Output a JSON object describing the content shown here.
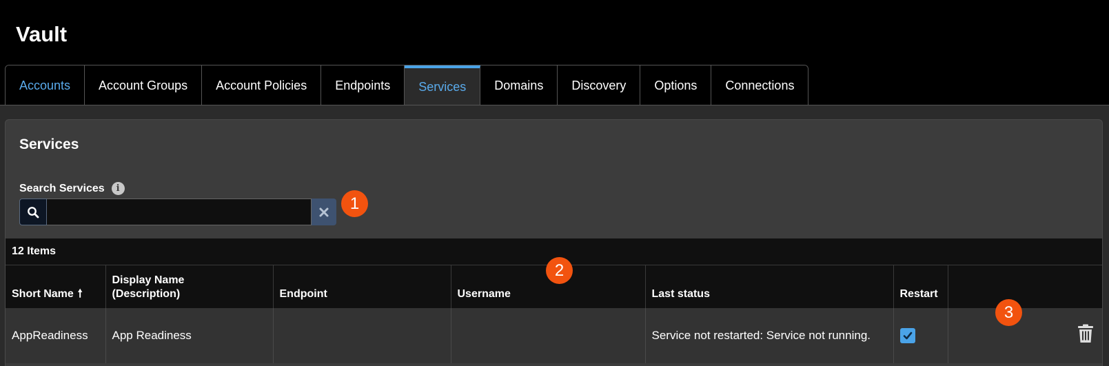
{
  "app": {
    "title": "Vault"
  },
  "tabs": [
    {
      "label": "Accounts",
      "state": "link"
    },
    {
      "label": "Account Groups",
      "state": "normal"
    },
    {
      "label": "Account Policies",
      "state": "normal"
    },
    {
      "label": "Endpoints",
      "state": "normal"
    },
    {
      "label": "Services",
      "state": "active"
    },
    {
      "label": "Domains",
      "state": "normal"
    },
    {
      "label": "Discovery",
      "state": "normal"
    },
    {
      "label": "Options",
      "state": "normal"
    },
    {
      "label": "Connections",
      "state": "normal"
    }
  ],
  "panel": {
    "title": "Services",
    "search": {
      "label": "Search Services",
      "value": "",
      "placeholder": ""
    }
  },
  "grid": {
    "count_label": "12 Items",
    "columns": [
      "Short Name",
      "Display Name\n(Description)",
      "Endpoint",
      "Username",
      "Last status",
      "Restart",
      ""
    ],
    "rows": [
      {
        "short_name": "AppReadiness",
        "display_name": "App Readiness",
        "endpoint": "",
        "username": "",
        "last_status": "Service not restarted: Service not running.",
        "restart": true
      }
    ]
  },
  "markers": [
    "1",
    "2",
    "3"
  ],
  "colors": {
    "accent": "#4aa3e8",
    "marker": "#f2530f",
    "tab_link": "#5aabec"
  },
  "icons": {
    "search": "search-icon",
    "clear": "close-icon",
    "info": "info-icon",
    "sort": "sort-ascending-icon",
    "check": "check-icon",
    "delete": "trash-icon"
  }
}
